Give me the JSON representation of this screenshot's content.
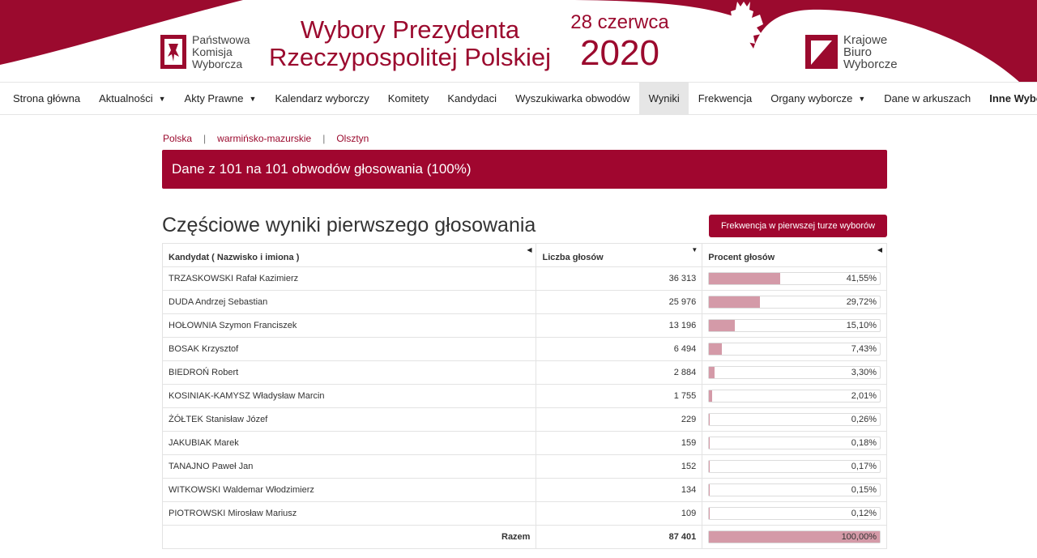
{
  "header": {
    "pkw_lines": [
      "Państwowa",
      "Komisja",
      "Wyborcza"
    ],
    "title_line1": "Wybory Prezydenta",
    "title_line2": "Rzeczypospolitej Polskiej",
    "date_line1": "28 czerwca",
    "date_line2": "2020",
    "kbw_lines": [
      "Krajowe",
      "Biuro",
      "Wyborcze"
    ],
    "brand_color": "#9b0a2e"
  },
  "nav": [
    {
      "label": "Strona główna",
      "dropdown": false
    },
    {
      "label": "Aktualności",
      "dropdown": true
    },
    {
      "label": "Akty Prawne",
      "dropdown": true
    },
    {
      "label": "Kalendarz wyborczy",
      "dropdown": false
    },
    {
      "label": "Komitety",
      "dropdown": false
    },
    {
      "label": "Kandydaci",
      "dropdown": false
    },
    {
      "label": "Wyszukiwarka obwodów",
      "dropdown": false
    },
    {
      "label": "Wyniki",
      "dropdown": false,
      "active": true
    },
    {
      "label": "Frekwencja",
      "dropdown": false
    },
    {
      "label": "Organy wyborcze",
      "dropdown": true
    },
    {
      "label": "Dane w arkuszach",
      "dropdown": false
    },
    {
      "label": "Inne Wybory",
      "dropdown": false,
      "bold": true
    }
  ],
  "breadcrumb": [
    "Polska",
    "warmińsko-mazurskie",
    "Olsztyn"
  ],
  "banner": "Dane z 101 na 101 obwodów głosowania (100%)",
  "section_title": "Częściowe wyniki pierwszego głosowania",
  "turnout_button": "Frekwencja w pierwszej turze wyborów",
  "table": {
    "headers": [
      "Kandydat ( Nazwisko i imiona )",
      "Liczba głosów",
      "Procent głosów"
    ],
    "rows": [
      {
        "name": "TRZASKOWSKI Rafał Kazimierz",
        "votes": "36 313",
        "percent": "41,55%",
        "pct": 41.55
      },
      {
        "name": "DUDA Andrzej Sebastian",
        "votes": "25 976",
        "percent": "29,72%",
        "pct": 29.72
      },
      {
        "name": "HOŁOWNIA Szymon Franciszek",
        "votes": "13 196",
        "percent": "15,10%",
        "pct": 15.1
      },
      {
        "name": "BOSAK Krzysztof",
        "votes": "6 494",
        "percent": "7,43%",
        "pct": 7.43
      },
      {
        "name": "BIEDROŃ Robert",
        "votes": "2 884",
        "percent": "3,30%",
        "pct": 3.3
      },
      {
        "name": "KOSINIAK-KAMYSZ Władysław Marcin",
        "votes": "1 755",
        "percent": "2,01%",
        "pct": 2.01
      },
      {
        "name": "ŻÓŁTEK Stanisław Józef",
        "votes": "229",
        "percent": "0,26%",
        "pct": 0.26
      },
      {
        "name": "JAKUBIAK Marek",
        "votes": "159",
        "percent": "0,18%",
        "pct": 0.18
      },
      {
        "name": "TANAJNO Paweł Jan",
        "votes": "152",
        "percent": "0,17%",
        "pct": 0.17
      },
      {
        "name": "WITKOWSKI Waldemar Włodzimierz",
        "votes": "134",
        "percent": "0,15%",
        "pct": 0.15
      },
      {
        "name": "PIOTROWSKI Mirosław Mariusz",
        "votes": "109",
        "percent": "0,12%",
        "pct": 0.12
      }
    ],
    "total": {
      "label": "Razem",
      "votes": "87 401",
      "percent": "100,00%",
      "pct": 100
    }
  }
}
